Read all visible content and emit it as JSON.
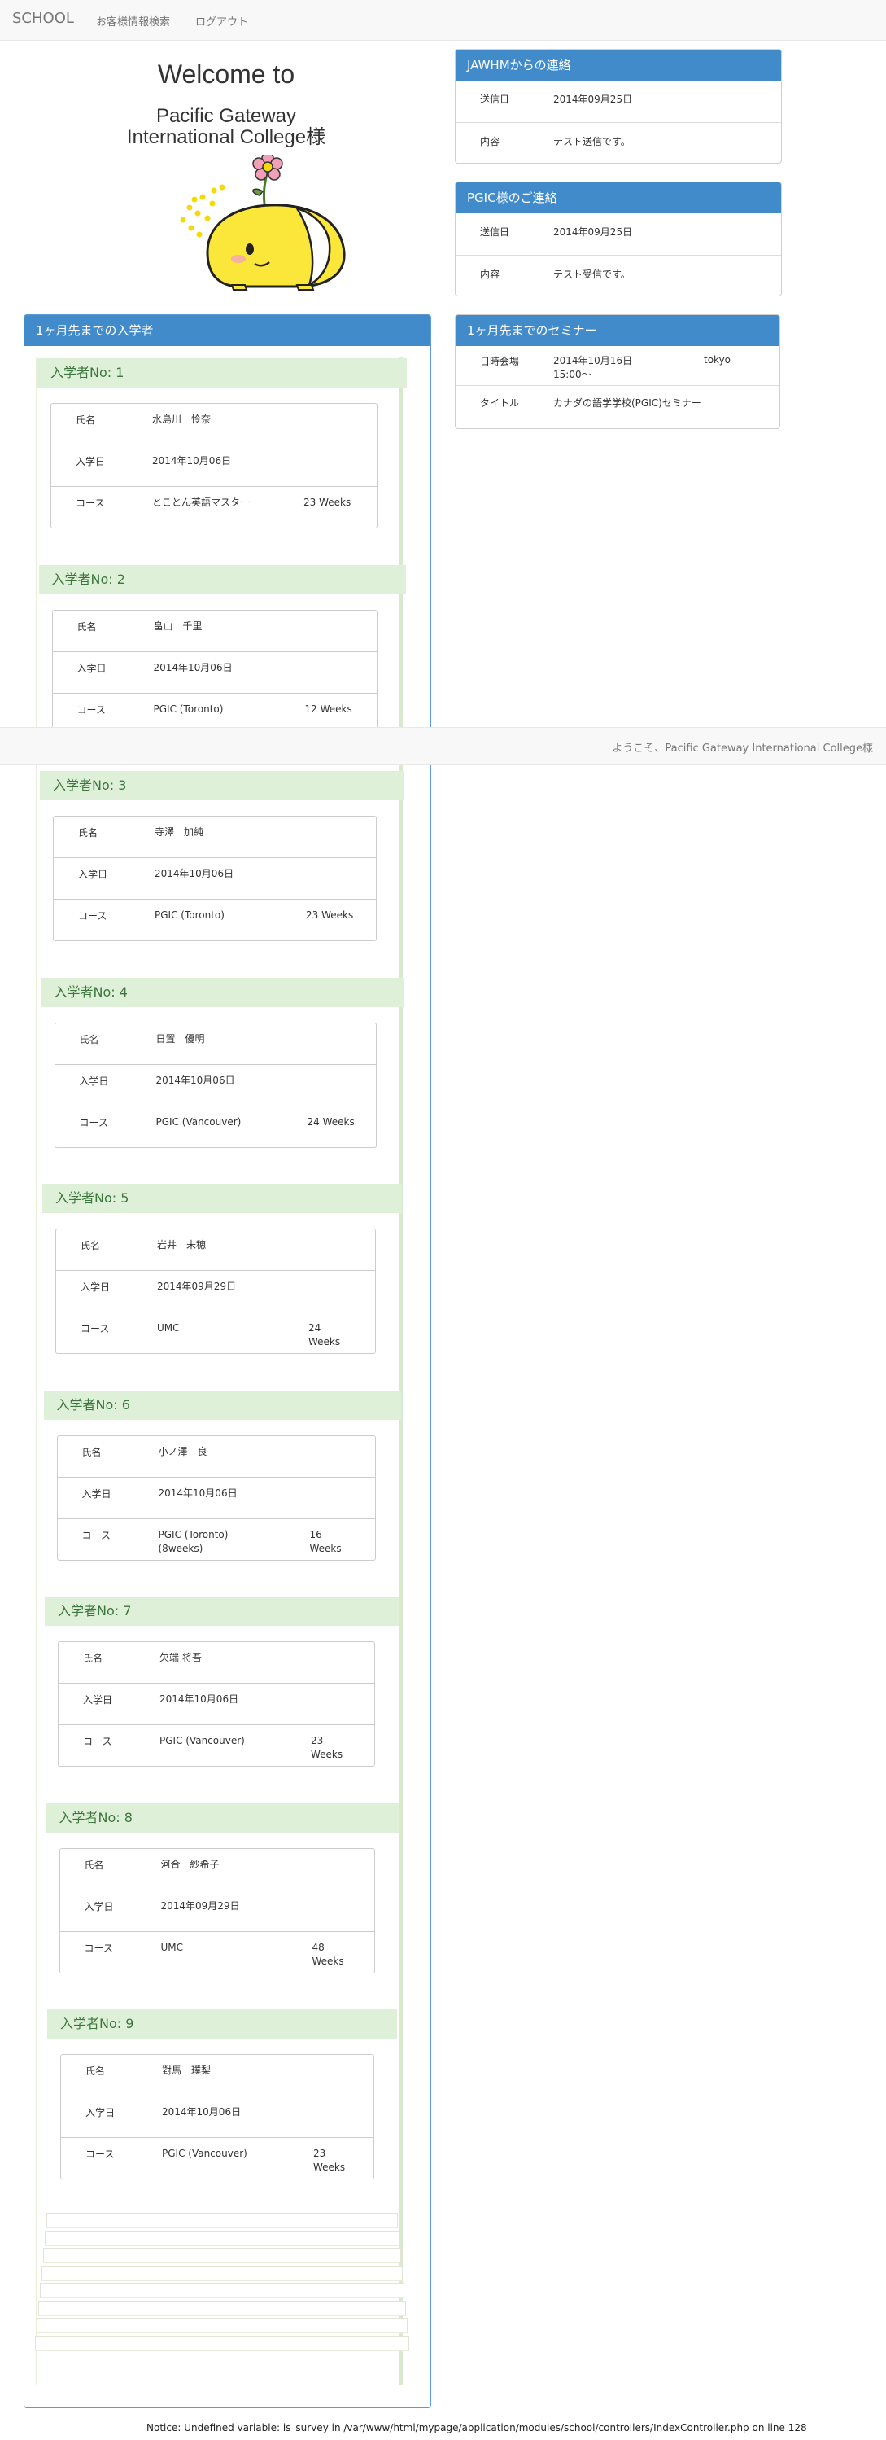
{
  "nav": {
    "brand": "SCHOOL",
    "links": [
      "お客様情報検索",
      "ログアウト"
    ]
  },
  "welcome": {
    "line1": "Welcome to",
    "line2": "Pacific Gateway",
    "line3": "International College様"
  },
  "jawhm": {
    "title": "JAWHMからの連絡",
    "rows": [
      {
        "label": "送信日",
        "value": "2014年09月25日"
      },
      {
        "label": "内容",
        "value": "テスト送信です。"
      }
    ]
  },
  "pgic": {
    "title": "PGIC様のご連絡",
    "rows": [
      {
        "label": "送信日",
        "value": "2014年09月25日"
      },
      {
        "label": "内容",
        "value": "テスト受信です。"
      }
    ]
  },
  "seminar": {
    "title": "1ヶ月先までのセミナー",
    "rows": [
      {
        "label": "日時会場",
        "value": "2014年10月16日\n15:00〜",
        "extra": "tokyo"
      },
      {
        "label": "タイトル",
        "value": "カナダの語学学校(PGIC)セミナー",
        "extra": ""
      }
    ]
  },
  "enrollees": {
    "title": "1ヶ月先までの入学者",
    "labels": {
      "name": "氏名",
      "date": "入学日",
      "course": "コース"
    },
    "students": [
      {
        "heading": "入学者No: 1",
        "name": "水島川　怜奈",
        "date": "2014年10月06日",
        "course": "とことん英語マスター",
        "weeks": "23 Weeks"
      },
      {
        "heading": "入学者No: 2",
        "name": "畠山　千里",
        "date": "2014年10月06日",
        "course": "PGIC (Toronto)",
        "weeks": "12 Weeks"
      },
      {
        "heading": "入学者No: 3",
        "name": "寺澤　加純",
        "date": "2014年10月06日",
        "course": "PGIC (Toronto)",
        "weeks": "23 Weeks"
      },
      {
        "heading": "入学者No: 4",
        "name": "日置　優明",
        "date": "2014年10月06日",
        "course": "PGIC (Vancouver)",
        "weeks": "24 Weeks"
      },
      {
        "heading": "入学者No: 5",
        "name": "岩井　未穂",
        "date": "2014年09月29日",
        "course": "UMC",
        "weeks": "24\nWeeks"
      },
      {
        "heading": "入学者No: 6",
        "name": "小ノ澤　良",
        "date": "2014年10月06日",
        "course": "PGIC (Toronto)\n(8weeks)",
        "weeks": "16\nWeeks"
      },
      {
        "heading": "入学者No: 7",
        "name": "欠端 将吾",
        "date": "2014年10月06日",
        "course": "PGIC (Vancouver)",
        "weeks": "23\nWeeks"
      },
      {
        "heading": "入学者No: 8",
        "name": "河合　紗希子",
        "date": "2014年09月29日",
        "course": "UMC",
        "weeks": "48\nWeeks"
      },
      {
        "heading": "入学者No: 9",
        "name": "對馬　璞梨",
        "date": "2014年10月06日",
        "course": "PGIC (Vancouver)",
        "weeks": "23\nWeeks"
      }
    ]
  },
  "footer": {
    "text": "ようこそ、Pacific Gateway International College様"
  },
  "notice": "Notice: Undefined variable: is_survey in /var/www/html/mypage/application/modules/school/controllers/IndexController.php on line 128"
}
